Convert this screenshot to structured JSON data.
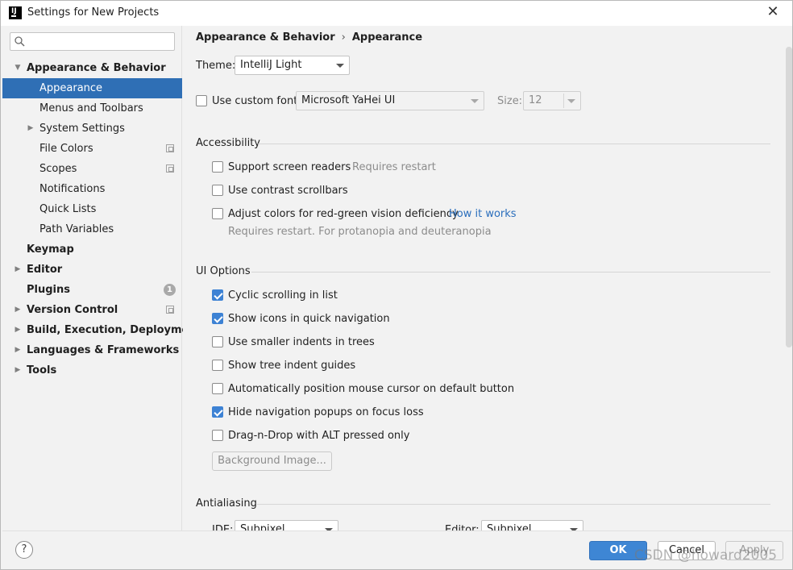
{
  "window": {
    "title": "Settings for New Projects",
    "close_glyph": "✕"
  },
  "search": {
    "placeholder": "",
    "value": ""
  },
  "sidebar": {
    "items": [
      {
        "label": "Appearance & Behavior"
      },
      {
        "label": "Appearance"
      },
      {
        "label": "Menus and Toolbars"
      },
      {
        "label": "System Settings"
      },
      {
        "label": "File Colors"
      },
      {
        "label": "Scopes"
      },
      {
        "label": "Notifications"
      },
      {
        "label": "Quick Lists"
      },
      {
        "label": "Path Variables"
      },
      {
        "label": "Keymap"
      },
      {
        "label": "Editor"
      },
      {
        "label": "Plugins",
        "badge": "1"
      },
      {
        "label": "Version Control"
      },
      {
        "label": "Build, Execution, Deployment"
      },
      {
        "label": "Languages & Frameworks"
      },
      {
        "label": "Tools"
      }
    ]
  },
  "breadcrumb": {
    "parent": "Appearance & Behavior",
    "sep": "›",
    "current": "Appearance"
  },
  "theme": {
    "label": "Theme:",
    "value": "IntelliJ Light"
  },
  "custom_font": {
    "label": "Use custom font:",
    "checked": false,
    "font": "Microsoft YaHei UI",
    "size_label": "Size:",
    "size": "12"
  },
  "accessibility": {
    "title": "Accessibility",
    "screen_readers": "Support screen readers",
    "screen_readers_note": "Requires restart",
    "contrast_scrollbars": "Use contrast scrollbars",
    "adjust_colors": "Adjust colors for red-green vision deficiency",
    "how_it_works": "How it works",
    "adjust_note": "Requires restart. For protanopia and deuteranopia"
  },
  "ui_options": {
    "title": "UI Options",
    "items": [
      {
        "label": "Cyclic scrolling in list",
        "checked": true
      },
      {
        "label": "Show icons in quick navigation",
        "checked": true
      },
      {
        "label": "Use smaller indents in trees",
        "checked": false
      },
      {
        "label": "Show tree indent guides",
        "checked": false
      },
      {
        "label": "Automatically position mouse cursor on default button",
        "checked": false
      },
      {
        "label": "Hide navigation popups on focus loss",
        "checked": true
      },
      {
        "label": "Drag-n-Drop with ALT pressed only",
        "checked": false
      }
    ],
    "background_image": "Background Image..."
  },
  "antialiasing": {
    "title": "Antialiasing",
    "ide_label": "IDE:",
    "ide_value": "Subpixel",
    "editor_label": "Editor:",
    "editor_value": "Subpixel"
  },
  "footer": {
    "help": "?",
    "ok": "OK",
    "cancel": "Cancel",
    "apply": "Apply"
  },
  "watermark": "CSDN @howard2005",
  "colors": {
    "selection": "#2f6fb5",
    "accent": "#3d82d4",
    "link": "#2a6ebc"
  }
}
